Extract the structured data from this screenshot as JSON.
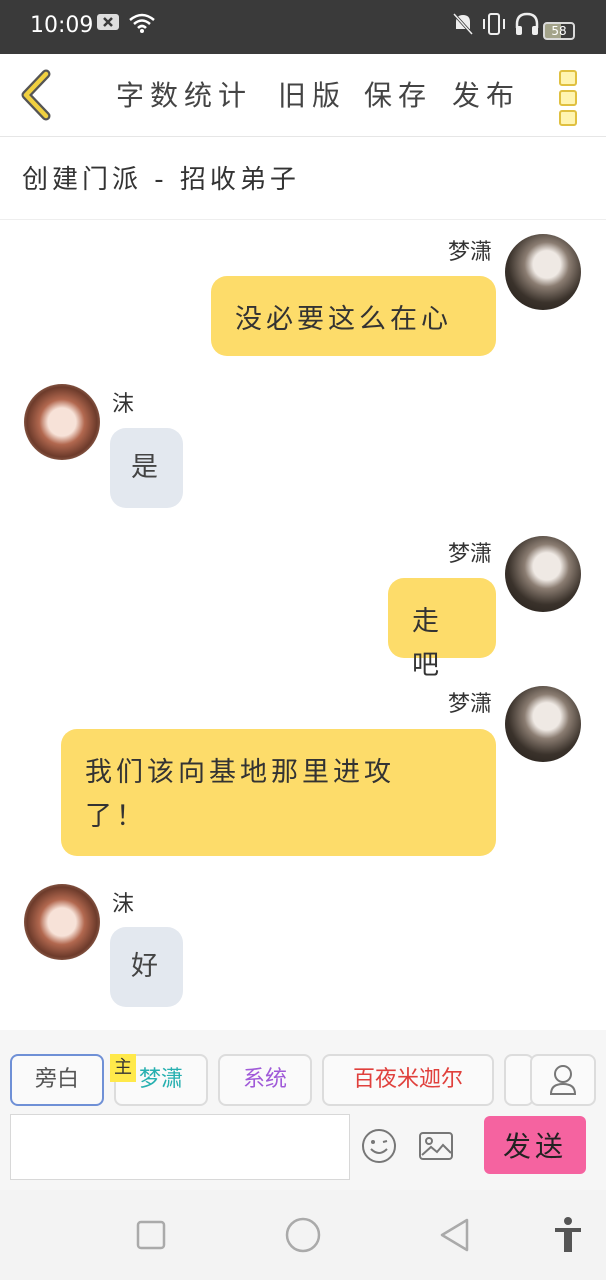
{
  "status_bar": {
    "time": "10:09",
    "battery": "58",
    "icons": [
      "close-box-icon",
      "wifi-icon",
      "bell-muted-icon",
      "vibrate-icon",
      "headphones-icon",
      "battery-icon"
    ]
  },
  "header": {
    "back_icon": "chevron-left-icon",
    "menu": [
      "字数统计",
      "旧版",
      "保存",
      "发布"
    ],
    "more_icon": "more-vertical-icon",
    "accent_color": "#e0c040"
  },
  "chat": {
    "title": "创建门派 - 招收弟子",
    "messages": [
      {
        "side": "right",
        "sender": "梦潇",
        "text": "没必要这么在心"
      },
      {
        "side": "left",
        "sender": "沫",
        "text": "是"
      },
      {
        "side": "right",
        "sender": "梦潇",
        "text": "走吧"
      },
      {
        "side": "right",
        "sender": "梦潇",
        "text": "我们该向基地那里进攻了！"
      },
      {
        "side": "left",
        "sender": "沫",
        "text": "好"
      }
    ],
    "bubble_colors": {
      "me": "#fddc6a",
      "other": "#e3e8ef"
    }
  },
  "roles": {
    "tag": "主",
    "items": [
      {
        "label": "旁白",
        "color": "#555555",
        "active": true
      },
      {
        "label": "梦潇",
        "color": "#27b0b0",
        "active": false
      },
      {
        "label": "系统",
        "color": "#a05ad8",
        "active": false
      },
      {
        "label": "百夜米迦尔",
        "color": "#e0403c",
        "active": false
      }
    ]
  },
  "composer": {
    "input_value": "",
    "emoji_icon": "smiley-icon",
    "image_icon": "image-icon",
    "send_label": "发送",
    "send_color": "#f563a0"
  },
  "nav_bar": {
    "icons": [
      "square-recents-icon",
      "circle-home-icon",
      "triangle-back-icon",
      "accessibility-icon"
    ]
  }
}
